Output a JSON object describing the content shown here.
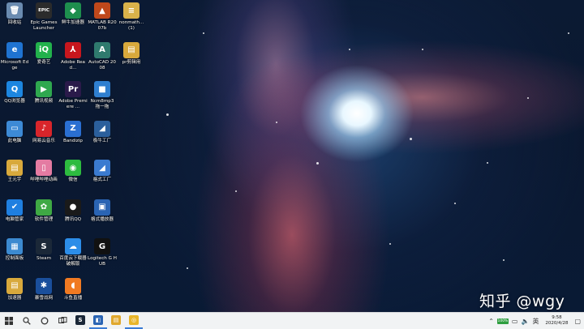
{
  "desktop_icons": [
    {
      "label": "回收站",
      "icon": "recycle-bin-icon",
      "glyph": "🗑",
      "color": "#6a8bb0"
    },
    {
      "label": "Epic Games Launcher",
      "icon": "epic-games-icon",
      "glyph": "EPIC",
      "color": "#2b2b2b"
    },
    {
      "label": "鲜牛加速器",
      "icon": "accelerator-icon",
      "glyph": "◆",
      "color": "#1e8f4e"
    },
    {
      "label": "MATLAB R2007b",
      "icon": "matlab-icon",
      "glyph": "▲",
      "color": "#c0481b"
    },
    {
      "label": "nonmath... (1)",
      "icon": "document-icon",
      "glyph": "≡",
      "color": "#d9b24a"
    },
    {
      "label": "Microsoft Edge",
      "icon": "edge-icon",
      "glyph": "e",
      "color": "#1f73d1"
    },
    {
      "label": "爱奇艺",
      "icon": "iqiyi-icon",
      "glyph": "iQ",
      "color": "#22b14c"
    },
    {
      "label": "Adobe Read...",
      "icon": "adobe-reader-icon",
      "glyph": "⅄",
      "color": "#c7161d"
    },
    {
      "label": "AutoCAD 2008",
      "icon": "autocad-icon",
      "glyph": "A",
      "color": "#2f7a6e"
    },
    {
      "label": "pr剪辑用",
      "icon": "folder-icon",
      "glyph": "▤",
      "color": "#d8a93c"
    },
    {
      "label": "QQ浏览器",
      "icon": "qq-browser-icon",
      "glyph": "Q",
      "color": "#1c86e0"
    },
    {
      "label": "腾讯视频",
      "icon": "tencent-video-icon",
      "glyph": "▶",
      "color": "#2fa84f"
    },
    {
      "label": "Adobe Premiere ...",
      "icon": "premiere-icon",
      "glyph": "Pr",
      "color": "#2a1a4a"
    },
    {
      "label": "Ncm8mp3 拖一拖",
      "icon": "ncm-icon",
      "glyph": "■",
      "color": "#2f7fd0"
    },
    {
      "label": "此电脑",
      "icon": "this-pc-icon",
      "glyph": "▭",
      "color": "#3d8ad6"
    },
    {
      "label": "网易云音乐",
      "icon": "netease-music-icon",
      "glyph": "♪",
      "color": "#d8252b"
    },
    {
      "label": "Bandizip",
      "icon": "bandizip-icon",
      "glyph": "Z",
      "color": "#2a6fd2"
    },
    {
      "label": "极牛工厂",
      "icon": "app-icon",
      "glyph": "◢",
      "color": "#2b5f9c"
    },
    {
      "label": "王元宇",
      "icon": "user-folder-icon",
      "glyph": "▤",
      "color": "#d8a93c"
    },
    {
      "label": "哔哩哔哩动画",
      "icon": "bilibili-icon",
      "glyph": "▯",
      "color": "#e47ba2"
    },
    {
      "label": "微信",
      "icon": "wechat-icon",
      "glyph": "◉",
      "color": "#2dbb3f"
    },
    {
      "label": "格式工厂",
      "icon": "format-factory-icon",
      "glyph": "◢",
      "color": "#3b7bd0"
    },
    {
      "label": "电脑管家",
      "icon": "pc-manager-icon",
      "glyph": "✔",
      "color": "#1f7fe0"
    },
    {
      "label": "软件管理",
      "icon": "software-manager-icon",
      "glyph": "✿",
      "color": "#3fa944"
    },
    {
      "label": "腾讯QQ",
      "icon": "qq-icon",
      "glyph": "●",
      "color": "#1a1a1a"
    },
    {
      "label": "格式播放器",
      "icon": "media-player-icon",
      "glyph": "▣",
      "color": "#2a64b3"
    },
    {
      "label": "控制面板",
      "icon": "control-panel-icon",
      "glyph": "▦",
      "color": "#3c8ad0"
    },
    {
      "label": "Steam",
      "icon": "steam-icon",
      "glyph": "S",
      "color": "#1b2838"
    },
    {
      "label": "百度云下载器 破解版",
      "icon": "baidu-cloud-icon",
      "glyph": "☁",
      "color": "#2c8de8"
    },
    {
      "label": "Logitech G HUB",
      "icon": "logitech-icon",
      "glyph": "G",
      "color": "#111111"
    },
    {
      "label": "加速器",
      "icon": "accelerator-folder-icon",
      "glyph": "▤",
      "color": "#d8a93c"
    },
    {
      "label": "暴雪战网",
      "icon": "battle-net-icon",
      "glyph": "✱",
      "color": "#1a4f9c"
    },
    {
      "label": "斗鱼直播",
      "icon": "douyu-icon",
      "glyph": "◖",
      "color": "#f07a22"
    }
  ],
  "watermark": "知乎 @wgy",
  "taskbar": {
    "apps": [
      {
        "name": "steam",
        "icon": "steam-taskbar-icon",
        "glyph": "S",
        "color": "#1b2838",
        "active": false
      },
      {
        "name": "app",
        "icon": "app-taskbar-icon",
        "glyph": "◧",
        "color": "#2a64b3",
        "active": true
      },
      {
        "name": "file-explorer",
        "icon": "file-explorer-icon",
        "glyph": "▤",
        "color": "#e0a82e",
        "active": false
      },
      {
        "name": "chrome",
        "icon": "chrome-icon",
        "glyph": "◎",
        "color": "#e8b52a",
        "active": true
      }
    ],
    "battery_badge": "100%",
    "ime": "英",
    "time": "9:58",
    "date": "2020/4/28"
  }
}
